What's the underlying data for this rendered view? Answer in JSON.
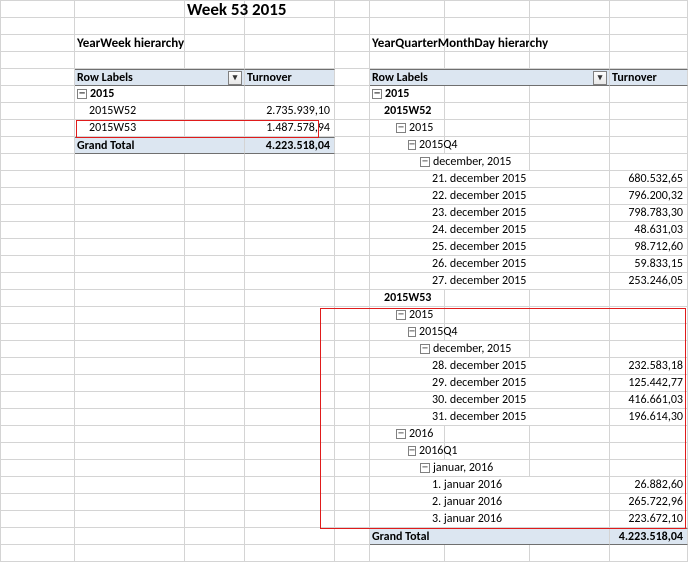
{
  "title": "Week 53 2015",
  "left": {
    "section": "YearWeek hierarchy",
    "col1": "Row Labels",
    "col2": "Turnover",
    "y2015": "2015",
    "w52": {
      "label": "2015W52",
      "value": "2.735.939,10"
    },
    "w53": {
      "label": "2015W53",
      "value": "1.487.578,94"
    },
    "grand_label": "Grand Total",
    "grand_value": "4.223.518,04"
  },
  "right": {
    "section": "YearQuarterMonthDay hierarchy",
    "col1": "Row Labels",
    "col2": "Turnover",
    "y2015": "2015",
    "w52": "2015W52",
    "y2015b": "2015",
    "q4": "2015Q4",
    "dec": "december, 2015",
    "d21": {
      "label": "21. december 2015",
      "value": "680.532,65"
    },
    "d22": {
      "label": "22. december 2015",
      "value": "796.200,32"
    },
    "d23": {
      "label": "23. december 2015",
      "value": "798.783,30"
    },
    "d24": {
      "label": "24. december 2015",
      "value": "48.631,03"
    },
    "d25": {
      "label": "25. december 2015",
      "value": "98.712,60"
    },
    "d26": {
      "label": "26. december 2015",
      "value": "59.833,15"
    },
    "d27": {
      "label": "27. december 2015",
      "value": "253.246,05"
    },
    "w53": "2015W53",
    "y2015c": "2015",
    "q4b": "2015Q4",
    "decb": "december, 2015",
    "d28": {
      "label": "28. december 2015",
      "value": "232.583,18"
    },
    "d29": {
      "label": "29. december 2015",
      "value": "125.442,77"
    },
    "d30": {
      "label": "30. december 2015",
      "value": "416.661,03"
    },
    "d31": {
      "label": "31. december 2015",
      "value": "196.614,30"
    },
    "y2016": "2016",
    "q1": "2016Q1",
    "jan": "januar, 2016",
    "j1": {
      "label": "1. januar 2016",
      "value": "26.882,60"
    },
    "j2": {
      "label": "2. januar 2016",
      "value": "265.722,96"
    },
    "j3": {
      "label": "3. januar 2016",
      "value": "223.672,10"
    },
    "grand_label": "Grand Total",
    "grand_value": "4.223.518,04"
  }
}
